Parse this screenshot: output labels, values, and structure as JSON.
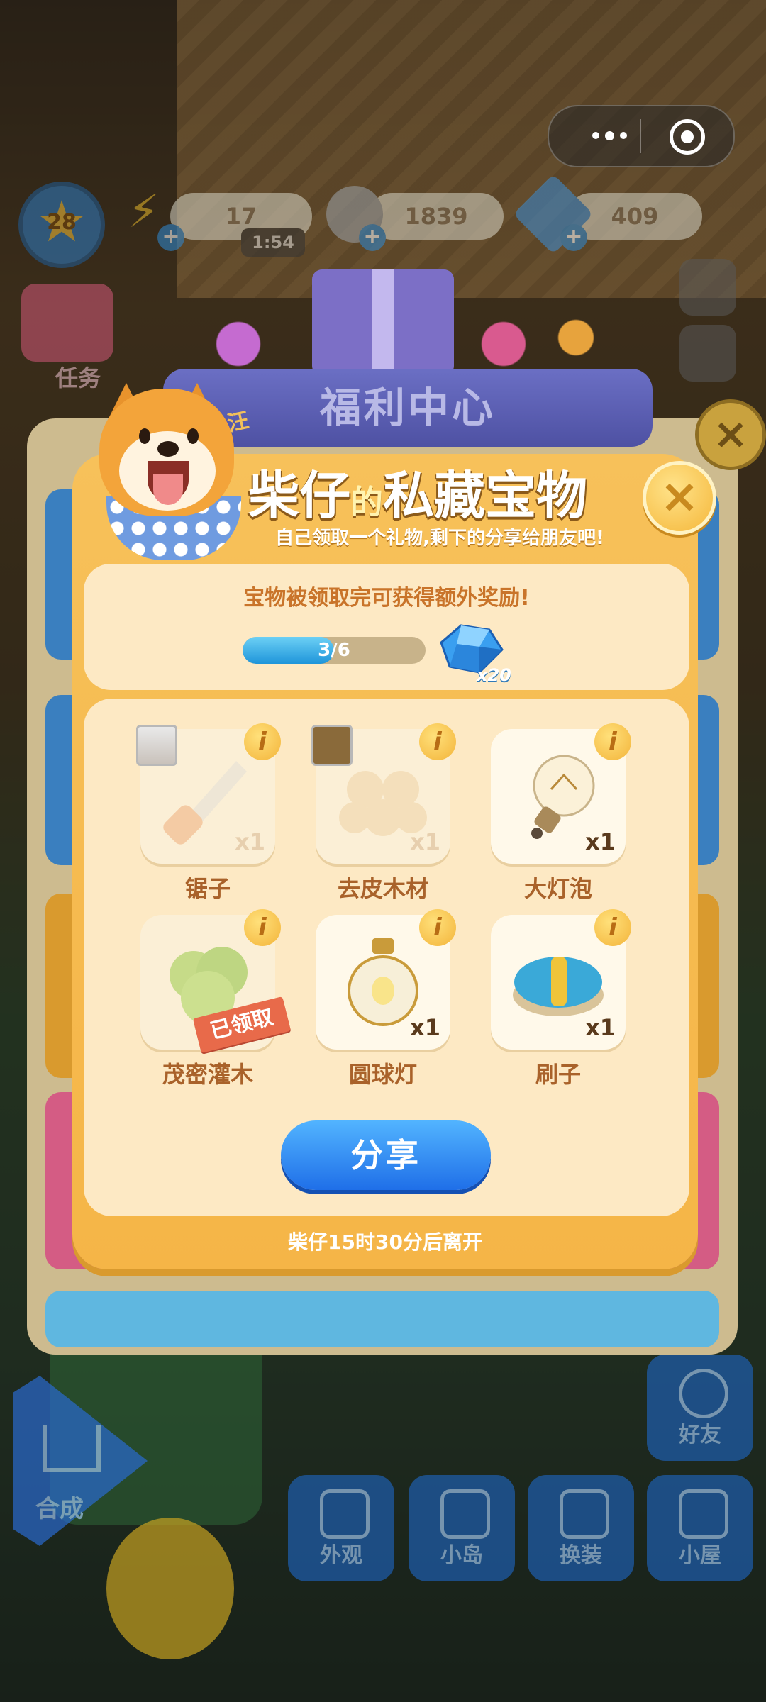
{
  "hud": {
    "level": "28",
    "energy": "17",
    "energy_timer": "1:54",
    "coins": "1839",
    "gems": "409",
    "task_label": "任务"
  },
  "back_panel": {
    "banner": "福利中心"
  },
  "dialog": {
    "title_part1": "柴仔",
    "title_part2": "的",
    "title_part3": "私藏宝物",
    "subtitle": "自己领取一个礼物,剩下的分享给朋友吧!",
    "dog_bark": "汪",
    "progress_text": "宝物被领取完可获得额外奖励!",
    "progress_label": "3/6",
    "progress_fraction": 0.5,
    "reward_count": "x20",
    "share_label": "分享",
    "leave_text": "柴仔15时30分后离开",
    "claimed_stamp": "已领取",
    "info_glyph": "i",
    "close_glyph": "×"
  },
  "items": [
    {
      "label": "锯子",
      "count": "x1",
      "icon": "saw-icon",
      "faded": true,
      "avatar": true
    },
    {
      "label": "去皮木材",
      "count": "x1",
      "icon": "logs-icon",
      "faded": true,
      "avatar": true
    },
    {
      "label": "大灯泡",
      "count": "x1",
      "icon": "light-bulb-icon",
      "faded": false
    },
    {
      "label": "茂密灌木",
      "count": "",
      "icon": "bush-icon",
      "faded": true,
      "claimed": true
    },
    {
      "label": "圆球灯",
      "count": "x1",
      "icon": "globe-lamp-icon",
      "faded": false
    },
    {
      "label": "刷子",
      "count": "x1",
      "icon": "brush-icon",
      "faded": false
    }
  ],
  "nav": {
    "home": "合成",
    "friends": "好友",
    "appearance": "外观",
    "island": "小岛",
    "outfit": "换装",
    "house": "小屋"
  },
  "colors": {
    "dialog_bg": "#f5b547",
    "card_bg": "#fde9c4",
    "accent_blue": "#1f6fe8",
    "item_label": "#a9622a"
  }
}
